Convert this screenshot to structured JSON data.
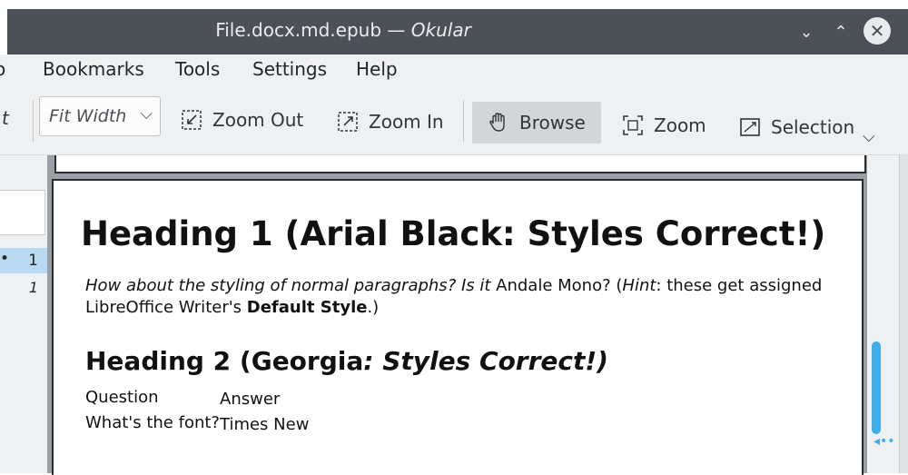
{
  "window": {
    "title_file": "File.docx.md.epub",
    "title_sep": " — ",
    "title_app": "Okular",
    "controls": {
      "minimize": "⌄",
      "maximize": "⌃",
      "close": "✕"
    }
  },
  "menubar": {
    "items": [
      {
        "label": "o"
      },
      {
        "label": "Bookmarks"
      },
      {
        "label": "Tools"
      },
      {
        "label": "Settings"
      },
      {
        "label": "Help"
      }
    ]
  },
  "toolbar": {
    "partial_label": "t",
    "zoom_combo": {
      "value": "Fit Width",
      "arrow": "⌵"
    },
    "zoom_out": "Zoom Out",
    "zoom_in": "Zoom In",
    "browse": "Browse",
    "zoom": "Zoom",
    "selection": "Selection",
    "more": "⌵"
  },
  "sidebar": {
    "rows": [
      {
        "dot": "•",
        "page": "1"
      },
      {
        "page": "1"
      }
    ]
  },
  "document": {
    "heading1": "Heading 1 (Arial Black: Styles Correct!)",
    "paragraph": {
      "lead": "How about the styling of normal paragraphs? Is it",
      "mid": " Andale Mono? (",
      "hint": "Hint",
      "after_hint": ": these get assigned LibreOffice Writer's ",
      "bold": "Default Style",
      "end": ".)"
    },
    "heading2": {
      "plain": "Heading 2 (Georgia",
      "italic": ": Styles Correct!)"
    },
    "table": {
      "headers": [
        "Question",
        "Answer"
      ],
      "rows": [
        [
          "What's the font?",
          "Times New"
        ]
      ]
    }
  },
  "colors": {
    "titlebar": "#4b5157",
    "chrome": "#eff0f1",
    "accent": "#3daee9",
    "viewport": "#9aa0a6"
  }
}
